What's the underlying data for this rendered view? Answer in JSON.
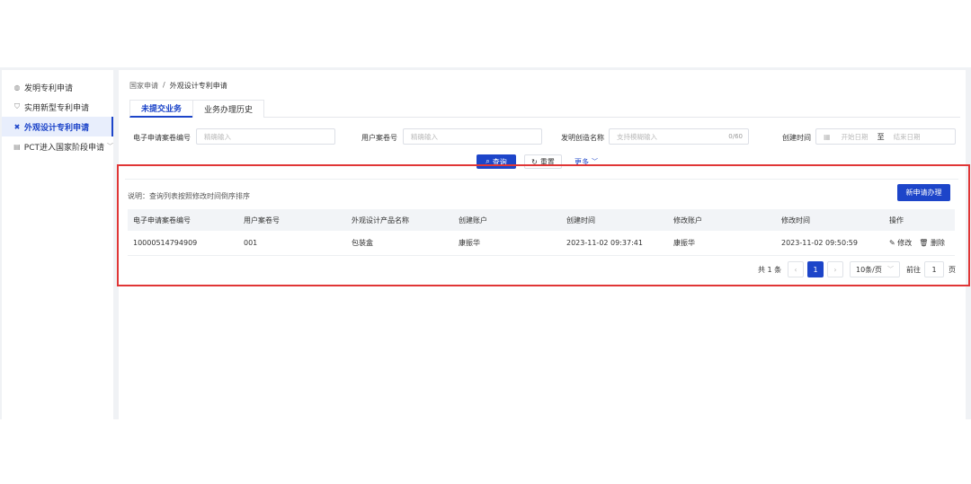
{
  "sidebar": {
    "items": [
      {
        "icon": "bulb-icon",
        "glyph": "💡",
        "label": "发明专利申请"
      },
      {
        "icon": "shield-icon",
        "glyph": "⛉",
        "label": "实用新型专利申请"
      },
      {
        "icon": "design-icon",
        "glyph": "✖",
        "label": "外观设计专利申请"
      },
      {
        "icon": "building-icon",
        "glyph": "▤",
        "label": "PCT进入国家阶段申请"
      }
    ]
  },
  "breadcrumb": {
    "root": "国家申请",
    "sep": "/",
    "current": "外观设计专利申请"
  },
  "tabs": [
    "未提交业务",
    "业务办理历史"
  ],
  "search": {
    "app_no_label": "电子申请案卷编号",
    "app_no_placeholder": "精确输入",
    "user_no_label": "用户案卷号",
    "user_no_placeholder": "精确输入",
    "name_label": "发明创造名称",
    "name_placeholder": "支持模糊输入",
    "name_counter": "0/60",
    "created_label": "创建时间",
    "start_placeholder": "开始日期",
    "range_sep": "至",
    "end_placeholder": "结束日期"
  },
  "actions": {
    "query": "查询",
    "reset": "重置",
    "more": "更多"
  },
  "results": {
    "note": "说明：查询列表按照修改时间倒序排序",
    "new_button": "新申请办理",
    "columns": [
      "电子申请案卷编号",
      "用户案卷号",
      "外观设计产品名称",
      "创建账户",
      "创建时间",
      "修改账户",
      "修改时间",
      "操作"
    ],
    "rows": [
      {
        "app_no": "10000514794909",
        "user_no": "001",
        "product": "包装盒",
        "creator": "康振华",
        "created": "2023-11-02 09:37:41",
        "modifier": "康振华",
        "modified": "2023-11-02 09:50:59",
        "edit": "修改",
        "delete": "删除"
      }
    ]
  },
  "pagination": {
    "total": "共 1 条",
    "current_page": "1",
    "page_size": "10条/页",
    "goto_label": "前往",
    "goto_value": "1",
    "page_unit": "页"
  },
  "colors": {
    "accent": "#1d45c9",
    "highlight_border": "#e03636"
  }
}
